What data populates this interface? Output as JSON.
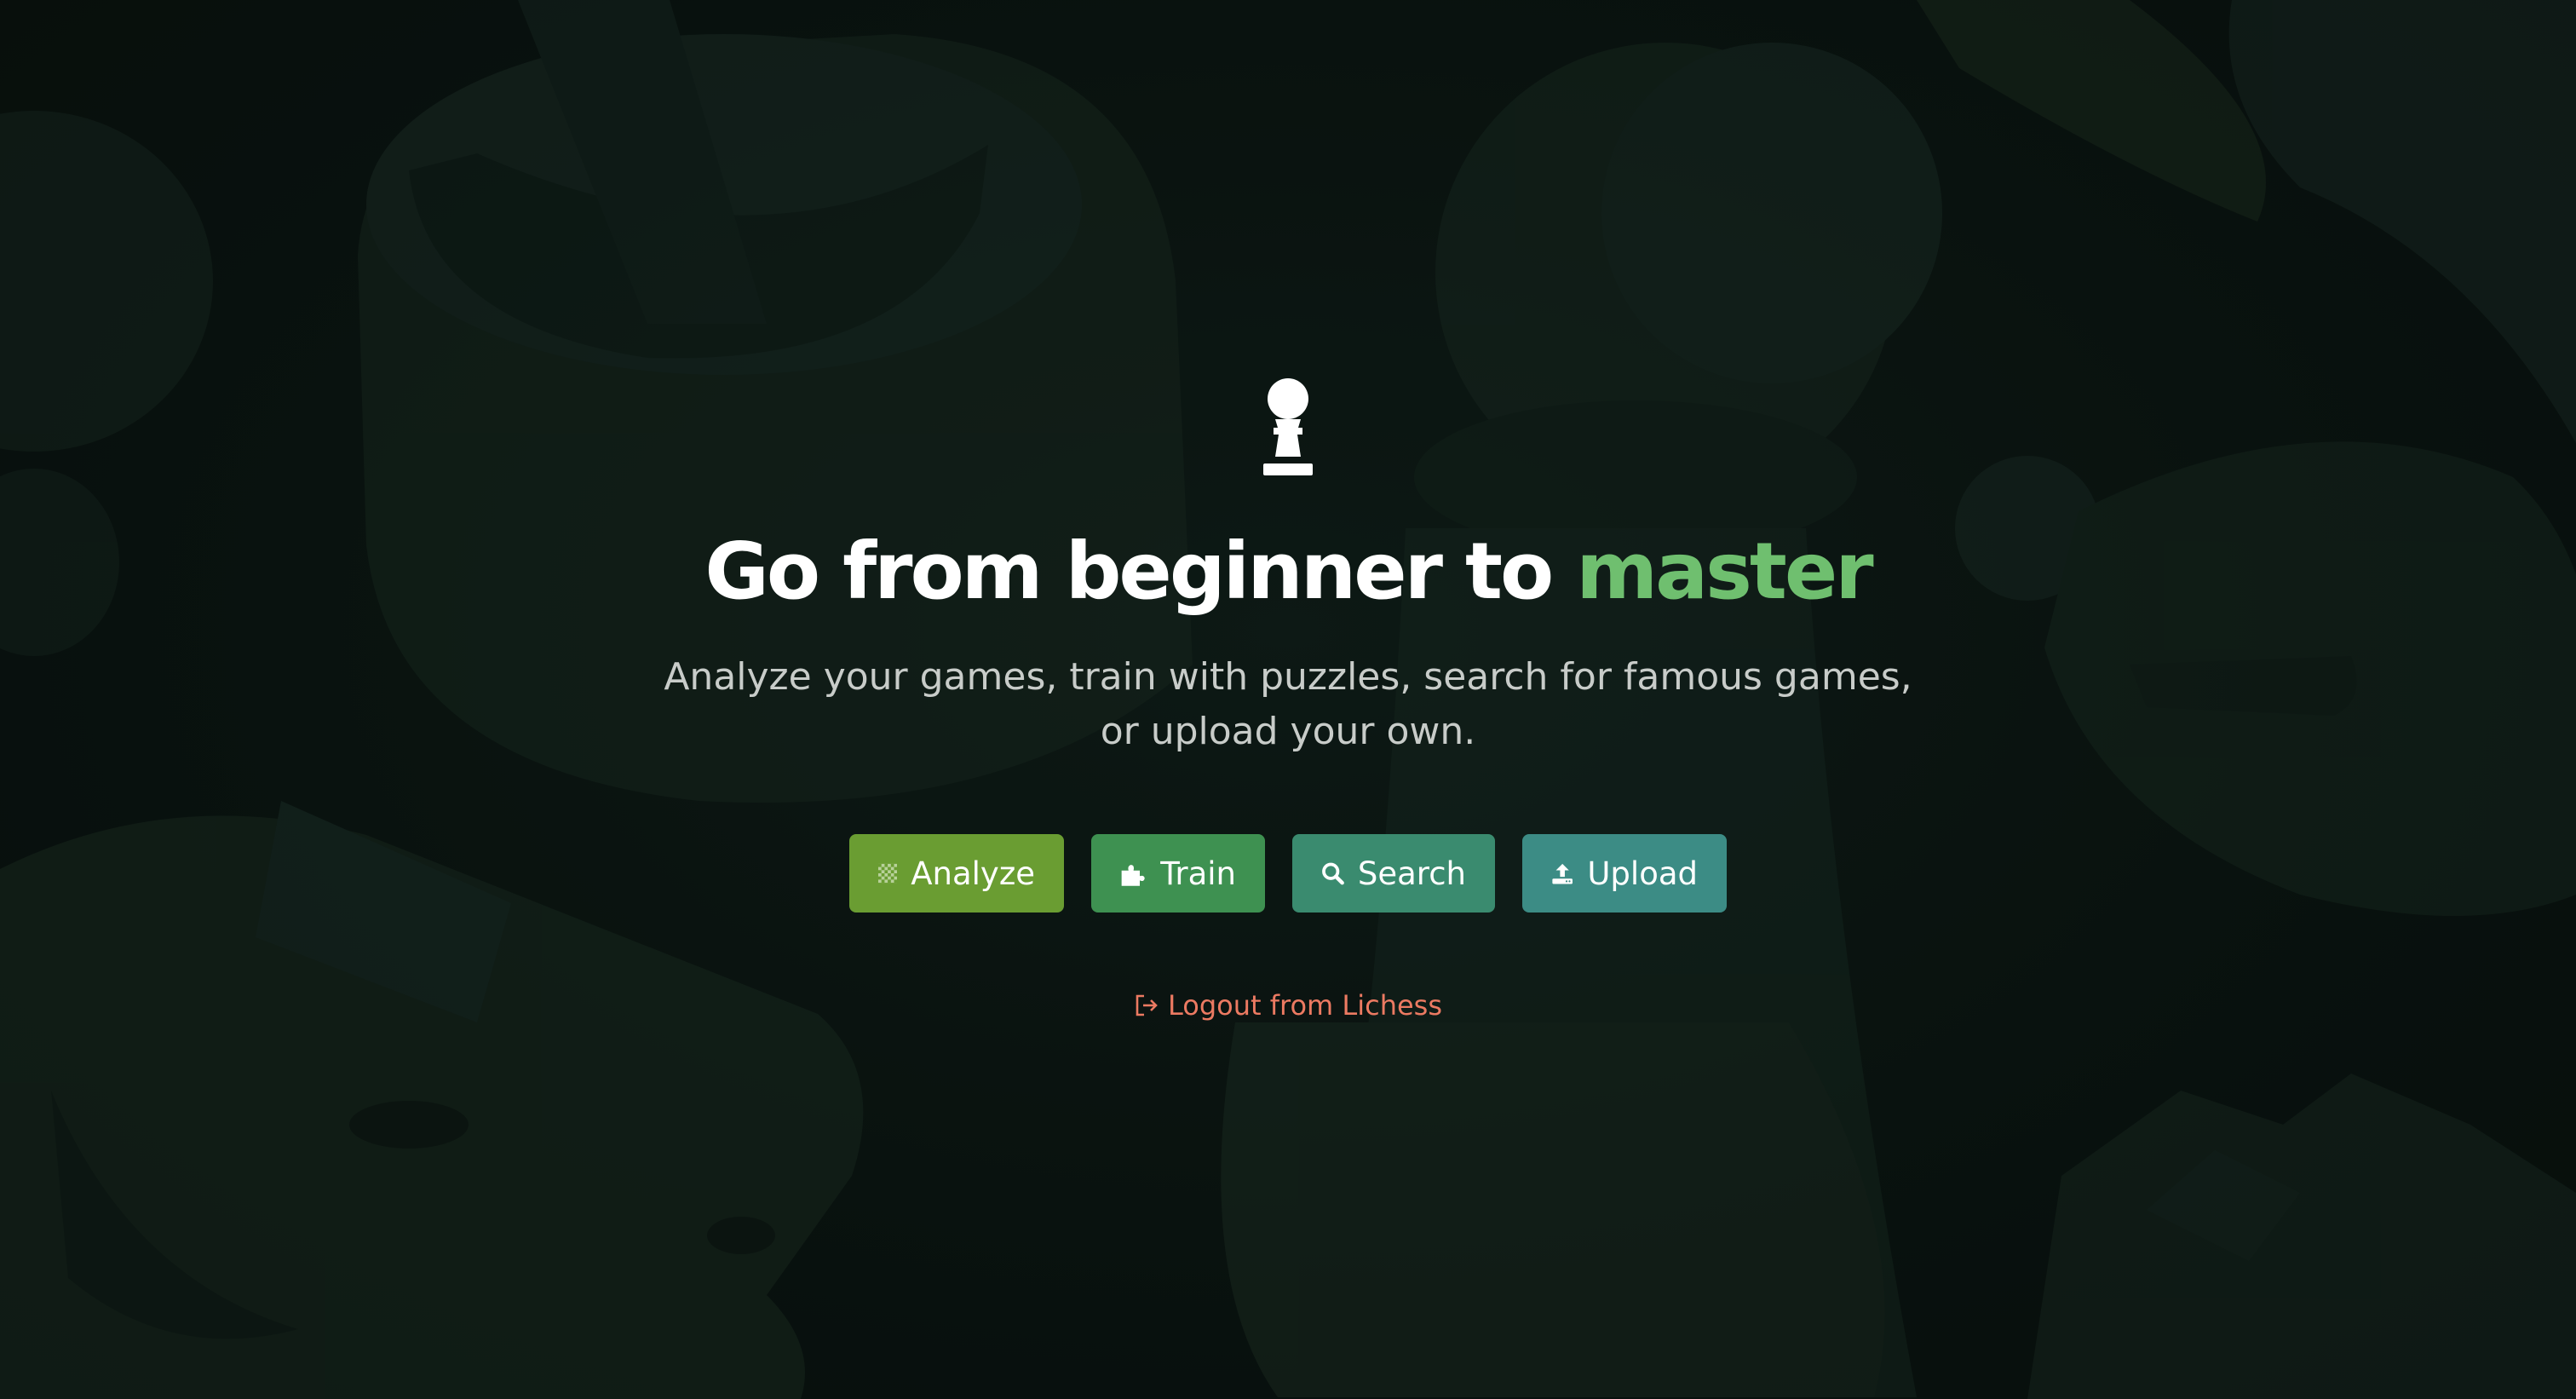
{
  "hero": {
    "logo_icon": "chess-pawn-icon",
    "headline_lead": "Go from beginner to ",
    "headline_accent": "master",
    "subtitle": "Analyze your games, train with puzzles, search for famous games, or upload your own."
  },
  "actions": {
    "analyze": {
      "label": "Analyze",
      "icon": "checkerboard-icon",
      "color": "#6a9d32"
    },
    "train": {
      "label": "Train",
      "icon": "puzzle-piece-icon",
      "color": "#3e9151"
    },
    "search": {
      "label": "Search",
      "icon": "search-icon",
      "color": "#3a8b6f"
    },
    "upload": {
      "label": "Upload",
      "icon": "upload-icon",
      "color": "#3c8c85"
    }
  },
  "logout": {
    "label": "Logout from Lichess",
    "icon": "logout-icon",
    "color": "#ec7a62"
  },
  "colors": {
    "accent_green": "#6fbf6f",
    "background": "#0b1512"
  }
}
